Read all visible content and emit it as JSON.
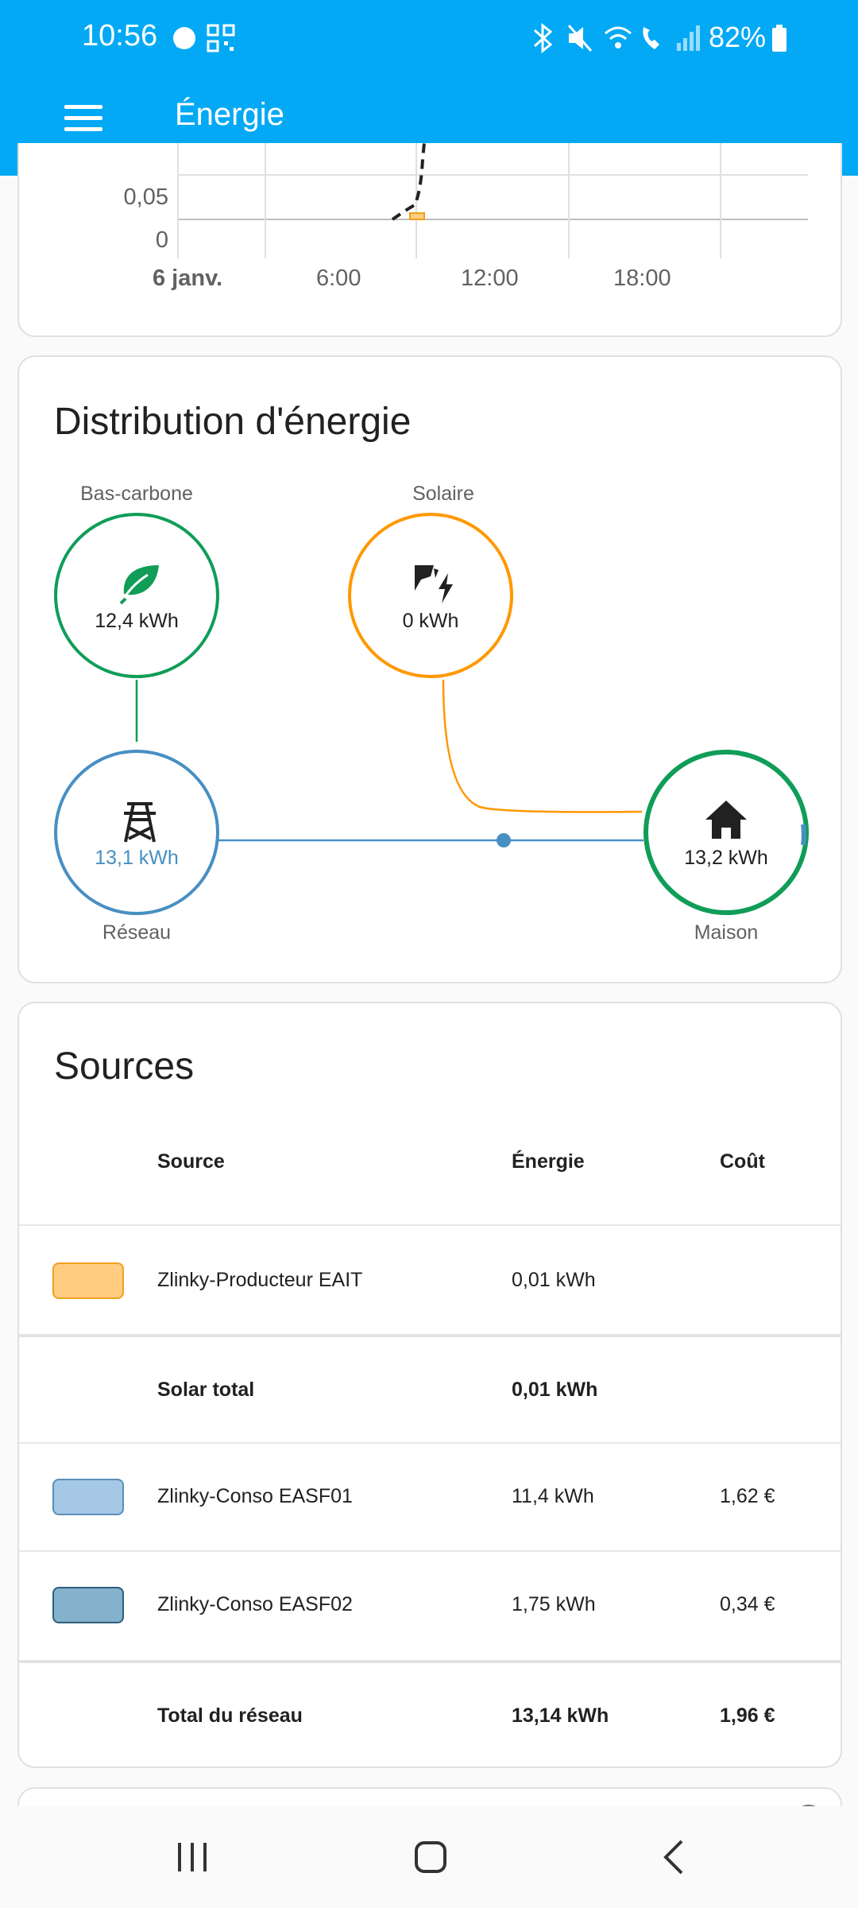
{
  "status_bar": {
    "time": "10:56",
    "battery": "82%"
  },
  "app_bar": {
    "title": "Énergie"
  },
  "chart": {
    "y_ticks": [
      "0,05",
      "0"
    ],
    "x_ticks": [
      "6 janv.",
      "6:00",
      "12:00",
      "18:00"
    ]
  },
  "distribution": {
    "title": "Distribution d'énergie",
    "nodes": {
      "low_carbon": {
        "label": "Bas-carbone",
        "value": "12,4 kWh",
        "color": "#0f9d58"
      },
      "solar": {
        "label": "Solaire",
        "value": "0 kWh",
        "color": "#ff9800"
      },
      "grid": {
        "label": "Réseau",
        "value": "13,1 kWh",
        "color": "#488fc2"
      },
      "home": {
        "label": "Maison",
        "value": "13,2 kWh",
        "color": "#0f9d58"
      }
    }
  },
  "sources": {
    "title": "Sources",
    "headers": {
      "source": "Source",
      "energy": "Énergie",
      "cost": "Coût"
    },
    "rows": [
      {
        "name": "Zlinky-Producteur EAIT",
        "energy": "0,01 kWh",
        "cost": "",
        "swatch_fill": "#ffcc80",
        "swatch_border": "#f0a020"
      },
      {
        "name": "Solar total",
        "energy": "0,01 kWh",
        "cost": ""
      },
      {
        "name": "Zlinky-Conso EASF01",
        "energy": "11,4 kWh",
        "cost": "1,62 €",
        "swatch_fill": "#a4c8e6",
        "swatch_border": "#5a8fb8"
      },
      {
        "name": "Zlinky-Conso EASF02",
        "energy": "1,75 kWh",
        "cost": "0,34 €",
        "swatch_fill": "#84b1cc",
        "swatch_border": "#2f5f7c"
      },
      {
        "name": "Total du réseau",
        "energy": "13,14 kWh",
        "cost": "1,96 €"
      }
    ]
  },
  "icons": {
    "menu": "menu-icon",
    "leaf": "leaf-icon",
    "solar": "solar-power-icon",
    "grid": "transmission-tower-icon",
    "home": "home-icon",
    "nav_recents": "recents-icon",
    "nav_home": "home-button-icon",
    "nav_back": "back-icon"
  }
}
